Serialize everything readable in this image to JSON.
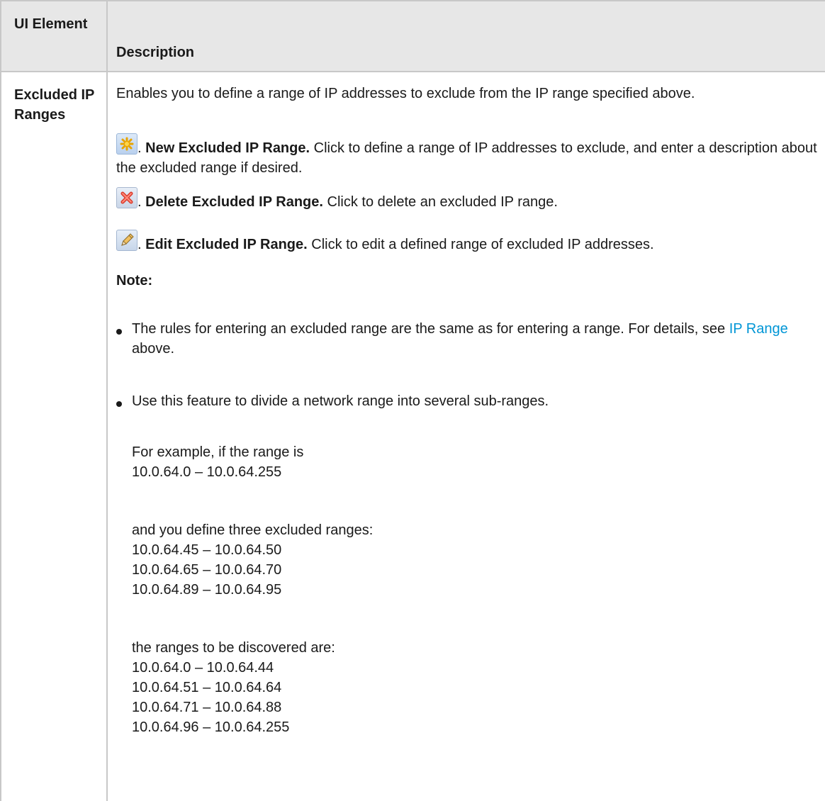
{
  "table": {
    "header": {
      "col1": "UI Element",
      "col2": "Description"
    },
    "row": {
      "element": "Excluded IP Ranges",
      "intro": "Enables you to define a range of IP addresses to exclude from the IP range specified above.",
      "actions": [
        {
          "icon": "new-star-icon",
          "name": "New Excluded IP Range.",
          "text": "Click to define a range of IP addresses to exclude, and enter a description about the excluded range if desired."
        },
        {
          "icon": "delete-x-icon",
          "name": "Delete Excluded IP Range.",
          "text": "Click to delete an excluded IP range."
        },
        {
          "icon": "pencil-edit-icon",
          "name": "Edit Excluded IP Range.",
          "text": "Click to edit a defined range of excluded IP addresses."
        }
      ],
      "note_label": "Note:",
      "bullets": [
        {
          "before_link": "The rules for entering an excluded range are the same as for entering a range. For details, see ",
          "link": "IP Range",
          "after_link": " above."
        },
        {
          "text": "Use this feature to divide a network range into several sub-ranges."
        }
      ],
      "example": {
        "intro_line": "For example, if the range is",
        "range": "10.0.64.0 – 10.0.64.255",
        "excluded_intro": "and you define three excluded ranges:",
        "excluded": [
          "10.0.64.45 – 10.0.64.50",
          "10.0.64.65 – 10.0.64.70",
          "10.0.64.89 – 10.0.64.95"
        ],
        "discovered_intro": "the ranges to be discovered are:",
        "discovered": [
          "10.0.64.0 – 10.0.64.44",
          "10.0.64.51 – 10.0.64.64",
          "10.0.64.71 – 10.0.64.88",
          "10.0.64.96 – 10.0.64.255"
        ]
      }
    }
  }
}
